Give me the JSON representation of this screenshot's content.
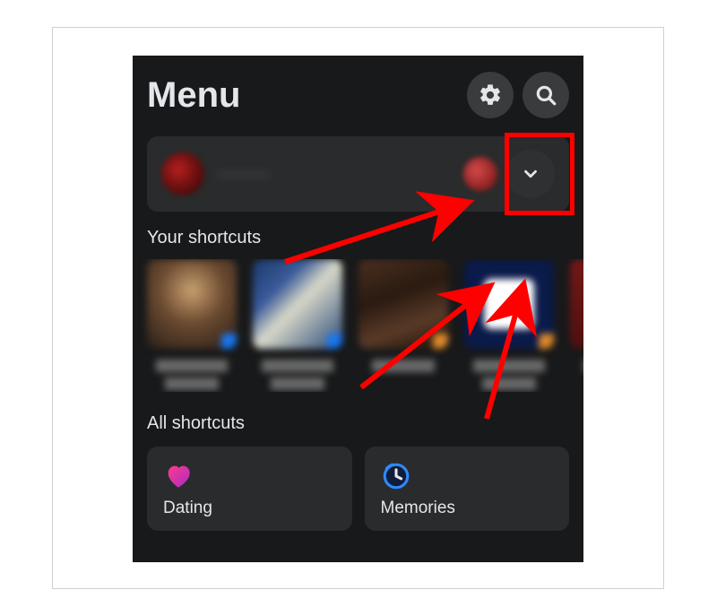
{
  "header": {
    "title": "Menu"
  },
  "profile": {
    "name": "········"
  },
  "sections": {
    "your_shortcuts_label": "Your shortcuts",
    "all_shortcuts_label": "All shortcuts"
  },
  "tiles": [
    {
      "label": "Dating",
      "icon": "heart-icon"
    },
    {
      "label": "Memories",
      "icon": "clock-icon"
    }
  ],
  "annotation": {
    "highlight_color": "#ff0000"
  }
}
